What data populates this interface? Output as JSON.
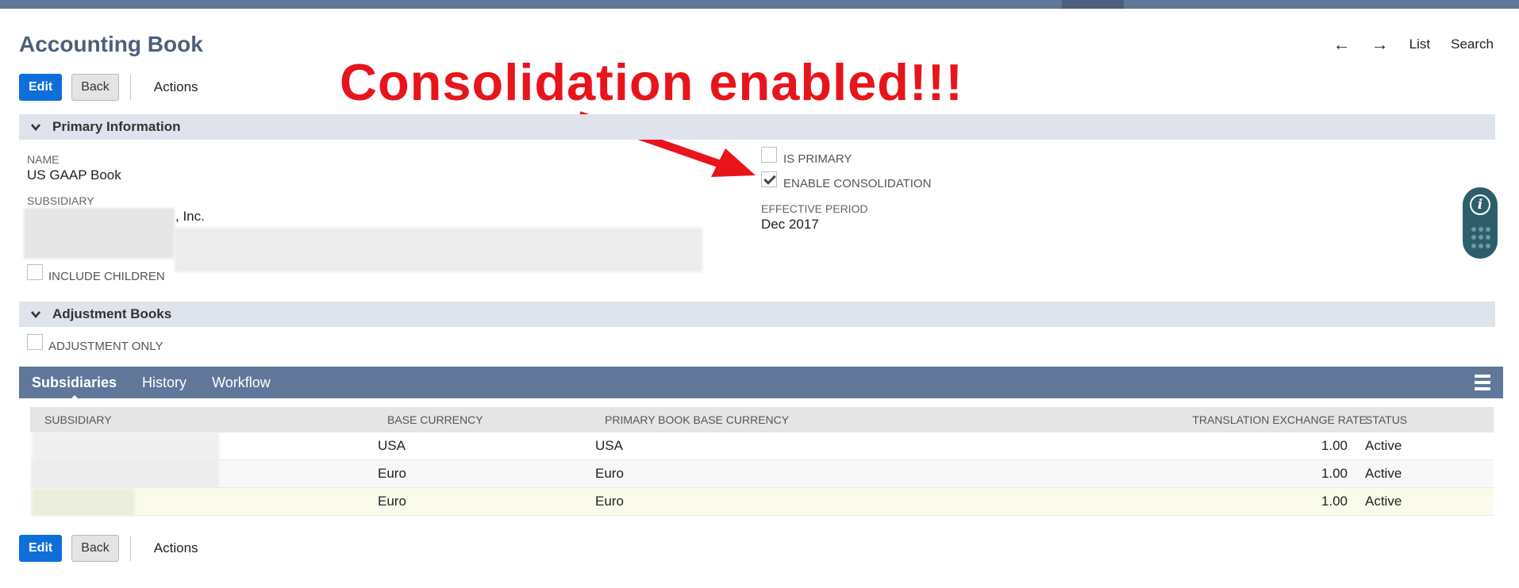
{
  "header": {
    "title": "Accounting Book",
    "nav": {
      "list": "List",
      "search": "Search",
      "back_arrow": "←",
      "forward_arrow": "→"
    }
  },
  "buttons": {
    "edit": "Edit",
    "back": "Back",
    "actions": "Actions"
  },
  "annotation": {
    "text": "Consolidation enabled!!!",
    "color": "#e8141c"
  },
  "primary_section": {
    "title": "Primary Information",
    "name_label": "NAME",
    "name_value": "US GAAP Book",
    "subsidiary_label": "SUBSIDIARY",
    "subsidiary_value": ", Inc.",
    "include_children_label": "INCLUDE CHILDREN",
    "include_children_checked": false,
    "is_primary_label": "IS PRIMARY",
    "is_primary_checked": false,
    "enable_consolidation_label": "ENABLE CONSOLIDATION",
    "enable_consolidation_checked": true,
    "effective_period_label": "EFFECTIVE PERIOD",
    "effective_period_value": "Dec 2017"
  },
  "adjustment_section": {
    "title": "Adjustment Books",
    "adjustment_only_label": "ADJUSTMENT ONLY",
    "adjustment_only_checked": false
  },
  "tabs": [
    {
      "label": "Subsidiaries",
      "active": true
    },
    {
      "label": "History",
      "active": false
    },
    {
      "label": "Workflow",
      "active": false
    }
  ],
  "table": {
    "columns": [
      "SUBSIDIARY",
      "BASE CURRENCY",
      "PRIMARY BOOK BASE CURRENCY",
      "TRANSLATION EXCHANGE RATE",
      "STATUS"
    ],
    "rows": [
      {
        "base_currency": "USA",
        "primary_currency": "USA",
        "rate": "1.00",
        "status": "Active"
      },
      {
        "base_currency": "Euro",
        "primary_currency": "Euro",
        "rate": "1.00",
        "status": "Active"
      },
      {
        "base_currency": "Euro",
        "primary_currency": "Euro",
        "rate": "1.00",
        "status": "Active"
      }
    ]
  },
  "colors": {
    "brand_blue": "#0e6fdb",
    "header_bar": "#607799",
    "section_bg": "#dfe3eb",
    "title_color": "#4d5f7a"
  },
  "icons": {
    "help": "info-icon",
    "menu": "hamburger-icon",
    "chevron": "chevron-down-icon"
  }
}
